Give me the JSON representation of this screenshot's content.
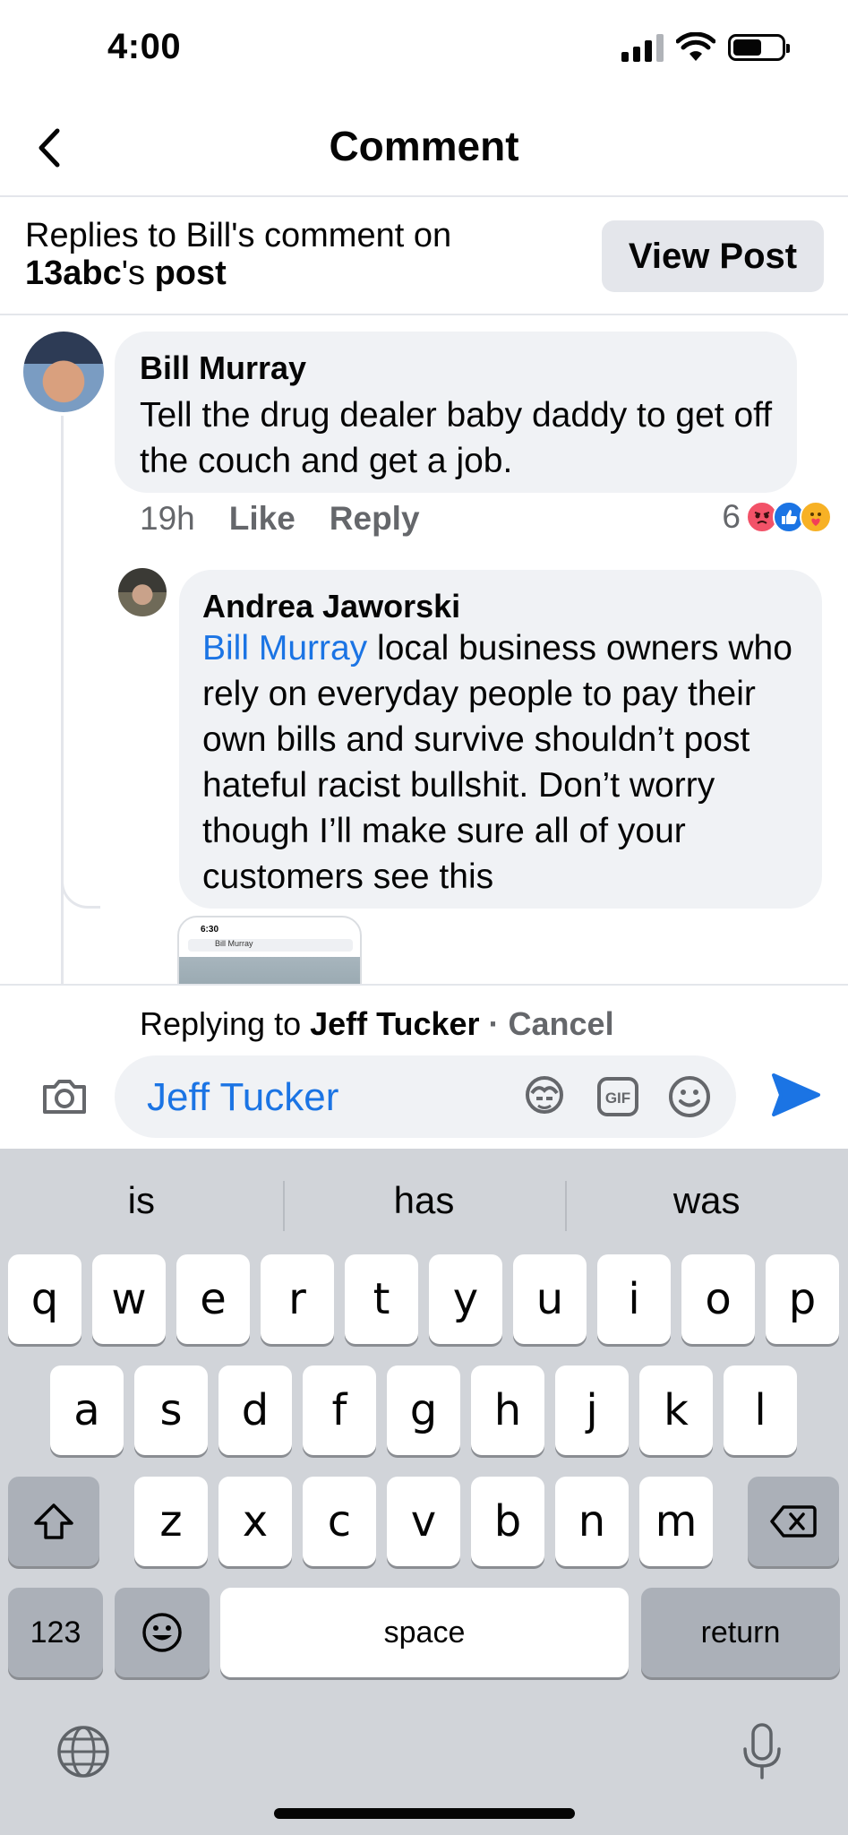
{
  "status_bar": {
    "time": "4:00"
  },
  "header": {
    "title": "Comment"
  },
  "context": {
    "prefix": "Replies to Bill's comment on",
    "page_name": "13abc",
    "possessive": "'s ",
    "post_word": "post",
    "view_post_label": "View Post"
  },
  "comments": [
    {
      "author": "Bill Murray",
      "text": "Tell the drug dealer baby daddy to get off the couch and get a job.",
      "time": "19h",
      "like_label": "Like",
      "reply_label": "Reply",
      "reaction_count": "6",
      "reactions": [
        "angry-react-icon",
        "like-react-icon",
        "care-react-icon"
      ]
    },
    {
      "author": "Andrea Jaworski",
      "mention": "Bill Murray",
      "text": " local business owners who rely on everyday people to pay their own bills and survive shouldn’t post hateful racist bullshit. Don’t worry though I’ll make sure all of your customers see this",
      "attachment": {
        "time": "6:30",
        "search_text": "Bill Murray"
      }
    }
  ],
  "composer": {
    "replying_prefix": "Replying to ",
    "replying_name": "Jeff Tucker",
    "separator": " · ",
    "cancel_label": "Cancel",
    "input_value": "Jeff Tucker"
  },
  "keyboard": {
    "predictions": [
      "is",
      "has",
      "was"
    ],
    "row1": [
      "q",
      "w",
      "e",
      "r",
      "t",
      "y",
      "u",
      "i",
      "o",
      "p"
    ],
    "row2": [
      "a",
      "s",
      "d",
      "f",
      "g",
      "h",
      "j",
      "k",
      "l"
    ],
    "row3": [
      "z",
      "x",
      "c",
      "v",
      "b",
      "n",
      "m"
    ],
    "numbers_label": "123",
    "space_label": "space",
    "return_label": "return"
  },
  "colors": {
    "accent": "#1b74e4",
    "bubble": "#f0f2f5",
    "keyboard": "#d1d4d9"
  }
}
